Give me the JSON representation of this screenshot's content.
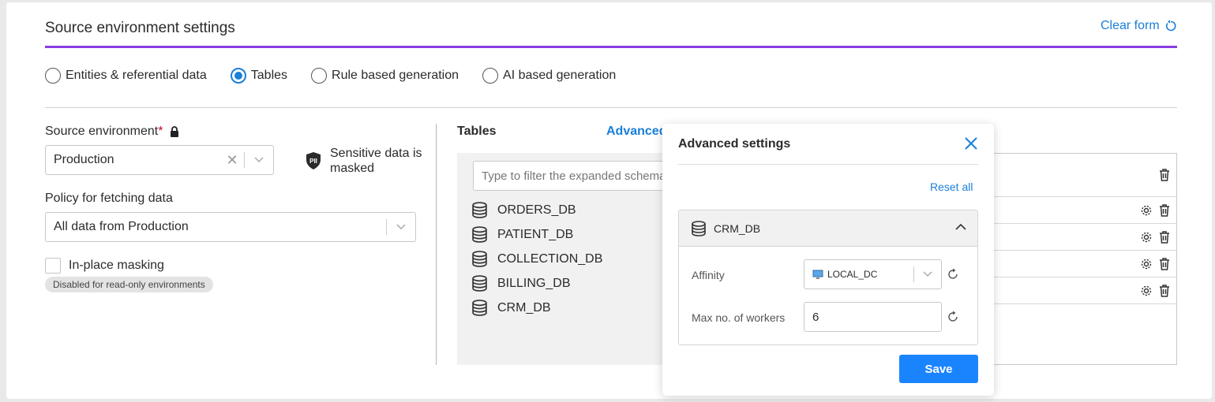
{
  "header": {
    "title": "Source environment settings",
    "clear_form": "Clear form"
  },
  "modes": [
    {
      "label": "Entities & referential data",
      "selected": false
    },
    {
      "label": "Tables",
      "selected": true
    },
    {
      "label": "Rule based generation",
      "selected": false
    },
    {
      "label": "AI based generation",
      "selected": false
    }
  ],
  "source_env": {
    "label": "Source environment",
    "required_mark": "*",
    "value": "Production",
    "sensitive_note": "Sensitive data is masked",
    "pii_badge": "PII"
  },
  "policy": {
    "label": "Policy for fetching data",
    "value": "All data from Production"
  },
  "masking": {
    "label": "In-place masking",
    "note": "Disabled for read-only environments",
    "checked": false
  },
  "tables": {
    "title": "Tables",
    "advanced_link": "Advanced",
    "filter_placeholder": "Type to filter the expanded schema",
    "databases": [
      "ORDERS_DB",
      "PATIENT_DB",
      "COLLECTION_DB",
      "BILLING_DB",
      "CRM_DB"
    ]
  },
  "modal": {
    "title": "Advanced settings",
    "reset_all": "Reset all",
    "section": "CRM_DB",
    "affinity_label": "Affinity",
    "affinity_value": "LOCAL_DC",
    "workers_label": "Max no. of workers",
    "workers_value": "6",
    "save": "Save"
  },
  "colors": {
    "accent": "#1a7fd9",
    "purple": "#8a3ee0",
    "button": "#1a84ff"
  }
}
